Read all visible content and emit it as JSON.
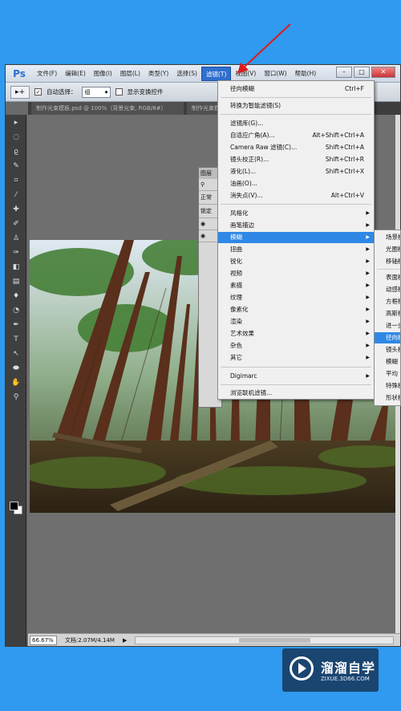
{
  "app": {
    "logo": "Ps"
  },
  "menubar": {
    "items": [
      "文件(F)",
      "编辑(E)",
      "图像(I)",
      "图层(L)",
      "类型(Y)",
      "选择(S)",
      "滤镜(T)",
      "视图(V)",
      "窗口(W)",
      "帮助(H)"
    ],
    "active": "滤镜(T)"
  },
  "options": {
    "auto_select_label": "自动选择：",
    "auto_select_value": "组",
    "show_transform_label": "显示变换控件"
  },
  "tabs": [
    "制作光束模板.psd @ 100%（背景光束, RGB/8#）",
    "制作光束模板.psd"
  ],
  "layers_panel": {
    "title": "图层",
    "mode": "正常",
    "lock": "锁定"
  },
  "filter_menu": {
    "items": [
      {
        "label": "径向模糊",
        "shortcut": "Ctrl+F"
      },
      {
        "label": "转换为智能滤镜(S)"
      },
      {
        "label": "滤镜库(G)..."
      },
      {
        "label": "自适应广角(A)...",
        "shortcut": "Alt+Shift+Ctrl+A"
      },
      {
        "label": "Camera Raw 滤镜(C)...",
        "shortcut": "Shift+Ctrl+A"
      },
      {
        "label": "镜头校正(R)...",
        "shortcut": "Shift+Ctrl+R"
      },
      {
        "label": "液化(L)...",
        "shortcut": "Shift+Ctrl+X"
      },
      {
        "label": "油画(O)..."
      },
      {
        "label": "消失点(V)...",
        "shortcut": "Alt+Ctrl+V"
      },
      {
        "label": "风格化"
      },
      {
        "label": "画笔描边"
      },
      {
        "label": "模糊"
      },
      {
        "label": "扭曲"
      },
      {
        "label": "锐化"
      },
      {
        "label": "视频"
      },
      {
        "label": "素描"
      },
      {
        "label": "纹理"
      },
      {
        "label": "像素化"
      },
      {
        "label": "渲染"
      },
      {
        "label": "艺术效果"
      },
      {
        "label": "杂色"
      },
      {
        "label": "其它"
      },
      {
        "label": "Digimarc"
      },
      {
        "label": "浏览联机滤镜..."
      }
    ]
  },
  "blur_submenu": {
    "items": [
      "场景模糊...",
      "光圈模糊...",
      "移轴模糊...",
      "表面模糊...",
      "动感模糊...",
      "方框模糊...",
      "高斯模糊...",
      "进一步模糊",
      "径向模糊...",
      "镜头模糊...",
      "模糊",
      "平均",
      "特殊模糊...",
      "形状模糊..."
    ]
  },
  "status": {
    "zoom": "66.67%",
    "doc_info": "文档:2.07M/4.14M"
  },
  "watermark": {
    "title": "溜溜自学",
    "subtitle": "ZIXUE.3D66.COM"
  },
  "colors": {
    "desktop": "#2f9aef",
    "highlight": "#2f88e6",
    "annotation_arrow": "#e01b1b"
  }
}
